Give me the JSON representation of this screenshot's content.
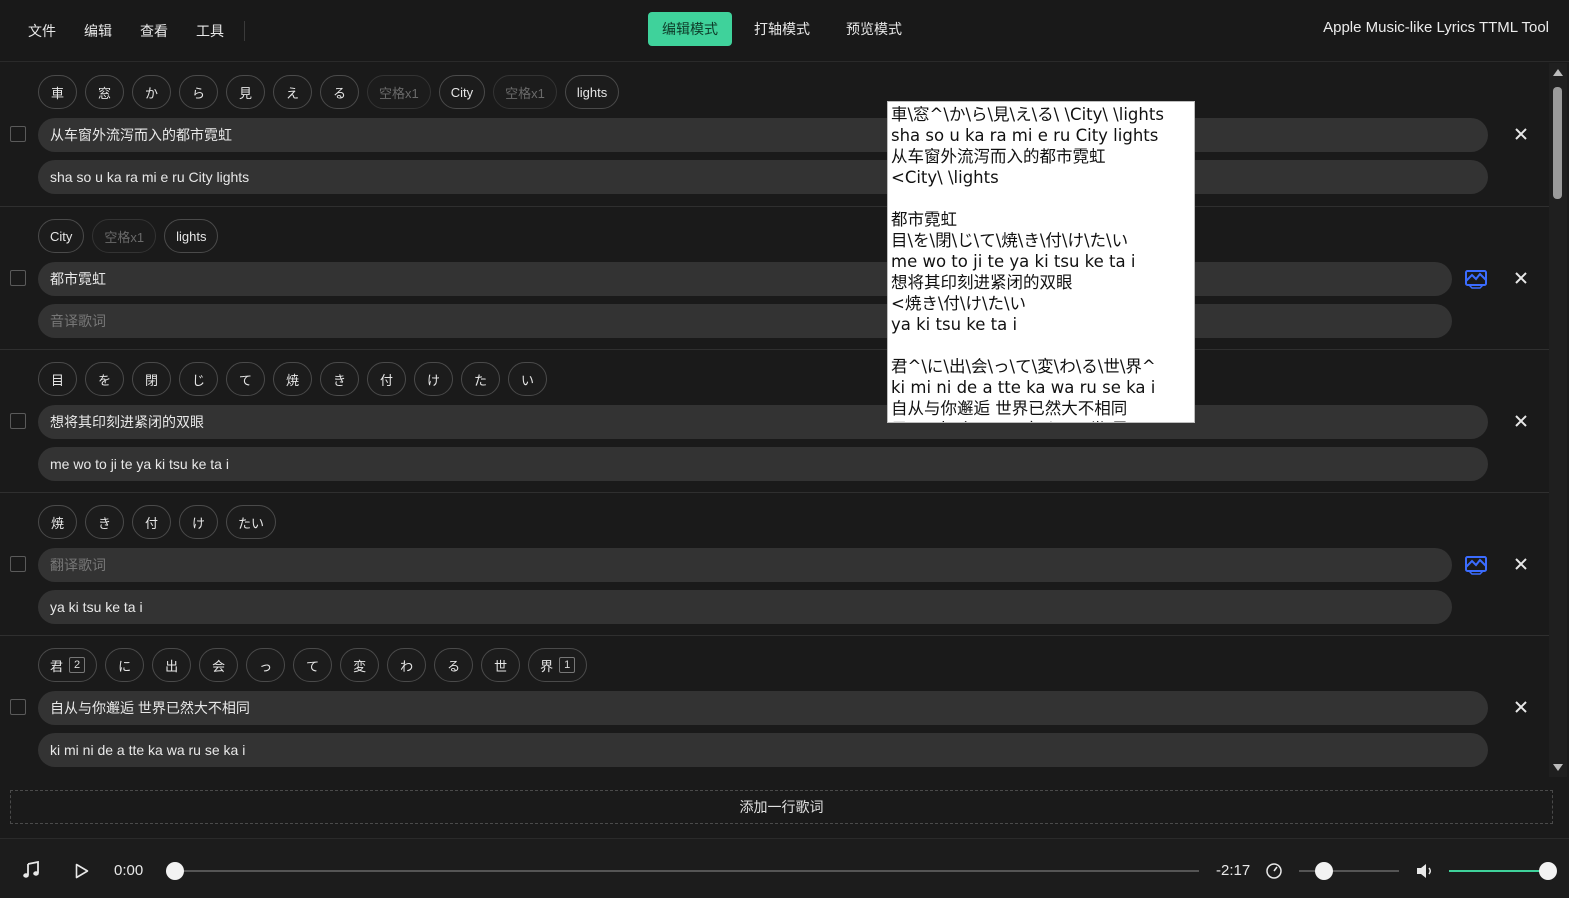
{
  "menus": [
    "文件",
    "编辑",
    "查看",
    "工具"
  ],
  "modes": [
    {
      "label": "编辑模式",
      "active": true
    },
    {
      "label": "打轴模式",
      "active": false
    },
    {
      "label": "预览模式",
      "active": false
    }
  ],
  "app_title": "Apple Music-like Lyrics TTML Tool",
  "rows": [
    {
      "chips": [
        {
          "text": "車"
        },
        {
          "text": "窓"
        },
        {
          "text": "か"
        },
        {
          "text": "ら"
        },
        {
          "text": "見"
        },
        {
          "text": "え"
        },
        {
          "text": "る"
        },
        {
          "text": "空格x1",
          "space": true
        },
        {
          "text": "City"
        },
        {
          "text": "空格x1",
          "space": true
        },
        {
          "text": "lights"
        }
      ],
      "translation": "从车窗外流泻而入的都市霓虹",
      "translation_placeholder": "翻译歌词",
      "romanization": "sha so u ka ra mi e ru City lights",
      "romanization_placeholder": "音译歌词",
      "merge": false
    },
    {
      "chips": [
        {
          "text": "City"
        },
        {
          "text": "空格x1",
          "space": true
        },
        {
          "text": "lights"
        }
      ],
      "translation": "都市霓虹",
      "translation_placeholder": "翻译歌词",
      "romanization": "",
      "romanization_placeholder": "音译歌词",
      "merge": true
    },
    {
      "chips": [
        {
          "text": "目"
        },
        {
          "text": "を"
        },
        {
          "text": "閉"
        },
        {
          "text": "じ"
        },
        {
          "text": "て"
        },
        {
          "text": "焼"
        },
        {
          "text": "き"
        },
        {
          "text": "付"
        },
        {
          "text": "け"
        },
        {
          "text": "た"
        },
        {
          "text": "い"
        }
      ],
      "translation": "想将其印刻进紧闭的双眼",
      "translation_placeholder": "翻译歌词",
      "romanization": "me wo to ji te ya ki tsu ke ta i",
      "romanization_placeholder": "音译歌词",
      "merge": false
    },
    {
      "chips": [
        {
          "text": "焼"
        },
        {
          "text": "き"
        },
        {
          "text": "付"
        },
        {
          "text": "け"
        },
        {
          "text": "たい"
        }
      ],
      "translation": "",
      "translation_placeholder": "翻译歌词",
      "romanization": "ya ki tsu ke ta i",
      "romanization_placeholder": "音译歌词",
      "merge": true
    },
    {
      "chips": [
        {
          "text": "君",
          "badge": "2"
        },
        {
          "text": "に"
        },
        {
          "text": "出"
        },
        {
          "text": "会"
        },
        {
          "text": "っ"
        },
        {
          "text": "て"
        },
        {
          "text": "変"
        },
        {
          "text": "わ"
        },
        {
          "text": "る"
        },
        {
          "text": "世"
        },
        {
          "text": "界",
          "badge": "1"
        }
      ],
      "translation": "自从与你邂逅 世界已然大不相同",
      "translation_placeholder": "翻译歌词",
      "romanization": "ki mi ni de a tte ka wa ru se ka i",
      "romanization_placeholder": "音译歌词",
      "merge": false
    }
  ],
  "add_line_label": "添加一行歌词",
  "popup_lines": [
    "車\\窓^\\か\\ら\\見\\え\\る\\ \\City\\ \\lights",
    "sha so u ka ra mi e ru City lights",
    "从车窗外流泻而入的都市霓虹",
    "<City\\ \\lights",
    "",
    "都市霓虹",
    "目\\を\\閉\\じ\\て\\焼\\き\\付\\け\\た\\い",
    "me wo to ji te ya ki tsu ke ta i",
    "想将其印刻进紧闭的双眼",
    "<焼き\\付\\け\\た\\い",
    "ya ki tsu ke ta i",
    "",
    "君^\\に\\出\\会\\っ\\て\\変\\わ\\る\\世\\界^",
    "ki mi ni de a tte ka wa ru se ka i",
    "自从与你邂逅 世界已然大不相同",
    "君\\に\\出\\会\\っ\\て\\変\\わ\\る\\世\\界"
  ],
  "player": {
    "current_time": "0:00",
    "remaining_time": "-2:17",
    "progress": 0,
    "speed_level": 0.25,
    "volume_level": 0.99
  },
  "colors": {
    "accent": "#3fd29b",
    "background": "#1a1a1a",
    "field": "#333333",
    "merge_icon": "#3b6cff"
  }
}
